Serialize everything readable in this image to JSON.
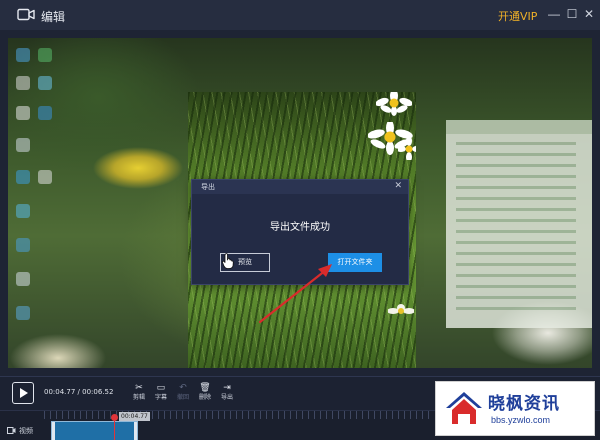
{
  "window": {
    "title": "编辑",
    "vip_label": "开通VIP",
    "controls": {
      "minimize": "—",
      "maximize": "☐",
      "close": "✕"
    }
  },
  "dialog": {
    "title": "导出",
    "close_glyph": "✕",
    "message": "导出文件成功",
    "preview_button": "预览",
    "open_folder_button": "打开文件夹"
  },
  "player": {
    "timecode": "00:04.77 / 00:06.52"
  },
  "toolbar": {
    "tools": [
      {
        "glyph": "✂",
        "label": "剪辑"
      },
      {
        "glyph": "▭",
        "label": "字幕"
      },
      {
        "glyph": "↶",
        "label": "撤回"
      },
      {
        "glyph": "🗑",
        "label": "删除"
      },
      {
        "glyph": "⇥",
        "label": "导出"
      }
    ]
  },
  "timeline": {
    "track_label": "视频",
    "playhead_time": "00:04.77"
  },
  "watermark": {
    "name": "晓枫资讯",
    "url": "bbs.yzwlo.com"
  },
  "colors": {
    "accent_blue": "#1d8fe6",
    "vip_gold": "#f0b128",
    "playhead_red": "#e0343a",
    "annotation_red": "#d92b2b"
  }
}
